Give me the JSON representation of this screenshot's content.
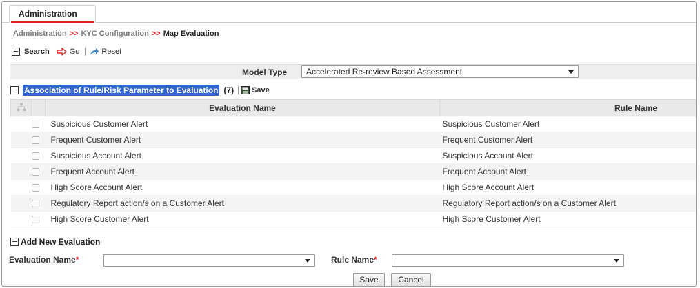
{
  "tabs": [
    {
      "label": "Administration",
      "active": true
    }
  ],
  "breadcrumb": {
    "items": [
      "Administration",
      "KYC Configuration"
    ],
    "separator": ">>",
    "current": "Map Evaluation"
  },
  "search_toolbar": {
    "title": "Search",
    "go_label": "Go",
    "reset_label": "Reset"
  },
  "model_type": {
    "label": "Model Type",
    "value": "Accelerated Re-review Based Assessment"
  },
  "grid": {
    "title": "Association of Rule/Risk Parameter to Evaluation",
    "count": "(7)",
    "save_label": "Save",
    "columns": [
      "Evaluation Name",
      "Rule Name"
    ],
    "rows": [
      {
        "evaluation": "Suspicious Customer Alert",
        "rule": "Suspicious Customer Alert"
      },
      {
        "evaluation": "Frequent Customer Alert",
        "rule": "Frequent Customer Alert"
      },
      {
        "evaluation": "Suspicious Account Alert",
        "rule": "Suspicious Account Alert"
      },
      {
        "evaluation": "Frequent Account Alert",
        "rule": "Frequent Account Alert"
      },
      {
        "evaluation": "High Score Account Alert",
        "rule": "High Score Account Alert"
      },
      {
        "evaluation": "Regulatory Report action/s on a Customer Alert",
        "rule": "Regulatory Report action/s on a Customer Alert"
      },
      {
        "evaluation": "High Score Customer Alert",
        "rule": "High Score Customer Alert"
      }
    ]
  },
  "add_section": {
    "title": "Add New Evaluation",
    "evaluation_label": "Evaluation Name",
    "rule_label": "Rule Name",
    "required_marker": "*",
    "evaluation_value": "",
    "rule_value": "",
    "save_label": "Save",
    "cancel_label": "Cancel"
  },
  "colors": {
    "accent_red": "#e02020",
    "highlight_blue": "#3366cc",
    "header_gray": "#e9e9e9"
  }
}
